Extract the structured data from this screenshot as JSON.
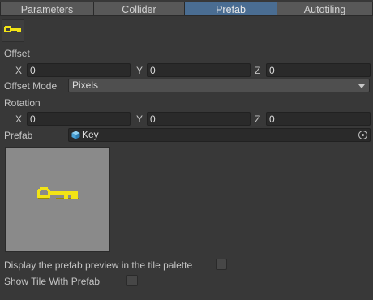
{
  "tabs": [
    {
      "label": "Parameters",
      "active": false
    },
    {
      "label": "Collider",
      "active": false
    },
    {
      "label": "Prefab",
      "active": true
    },
    {
      "label": "Autotiling",
      "active": false
    }
  ],
  "offset": {
    "section_label": "Offset",
    "x_label": "X",
    "x_value": "0",
    "y_label": "Y",
    "y_value": "0",
    "z_label": "Z",
    "z_value": "0"
  },
  "offset_mode": {
    "label": "Offset Mode",
    "value": "Pixels"
  },
  "rotation": {
    "section_label": "Rotation",
    "x_label": "X",
    "x_value": "0",
    "y_label": "Y",
    "y_value": "0",
    "z_label": "Z",
    "z_value": "0"
  },
  "prefab": {
    "label": "Prefab",
    "value": "Key",
    "icon": "prefab-cube-icon"
  },
  "preview": {
    "icon": "key-icon",
    "key_color": "#f2e416",
    "key_shadow": "#9a8d00"
  },
  "options": {
    "display_preview_label": "Display the prefab preview in the tile palette",
    "display_preview_checked": false,
    "show_tile_label": "Show Tile With Prefab",
    "show_tile_checked": false
  },
  "colors": {
    "background": "#383838",
    "tab_active": "#4a6d92",
    "field_bg": "#2a2a2a"
  }
}
